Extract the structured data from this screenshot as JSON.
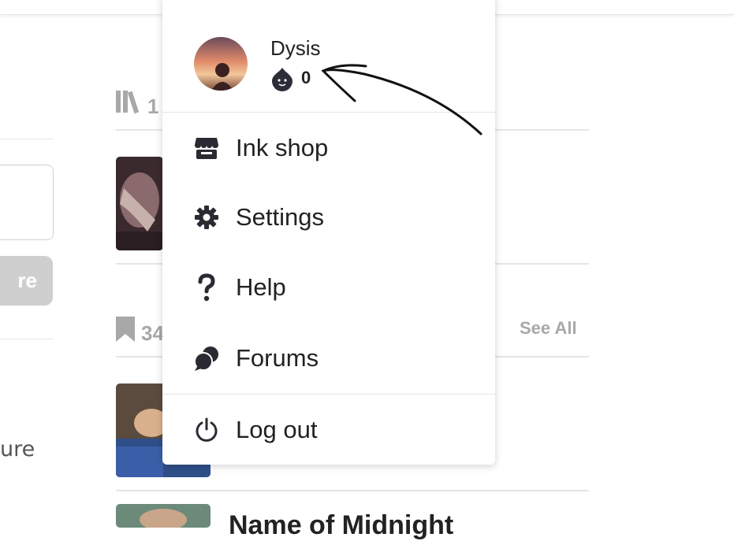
{
  "user": {
    "name": "Dysis",
    "coins": "0"
  },
  "menu": {
    "items": [
      {
        "label": "Ink shop",
        "icon": "store-icon"
      },
      {
        "label": "Settings",
        "icon": "gear-icon"
      },
      {
        "label": "Help",
        "icon": "question-icon"
      },
      {
        "label": "Forums",
        "icon": "chat-bubbles-icon"
      },
      {
        "label": "Log out",
        "icon": "power-icon"
      }
    ]
  },
  "background": {
    "library_count": "1",
    "reading_list_count": "34",
    "see_all": "See All",
    "left_button_fragment": "re",
    "left_text_fragment": "ure",
    "story_title_fragment": "Name of Midnight"
  },
  "colors": {
    "text": "#222222",
    "muted": "#a8a8a8",
    "divider": "#e5e5e5"
  }
}
